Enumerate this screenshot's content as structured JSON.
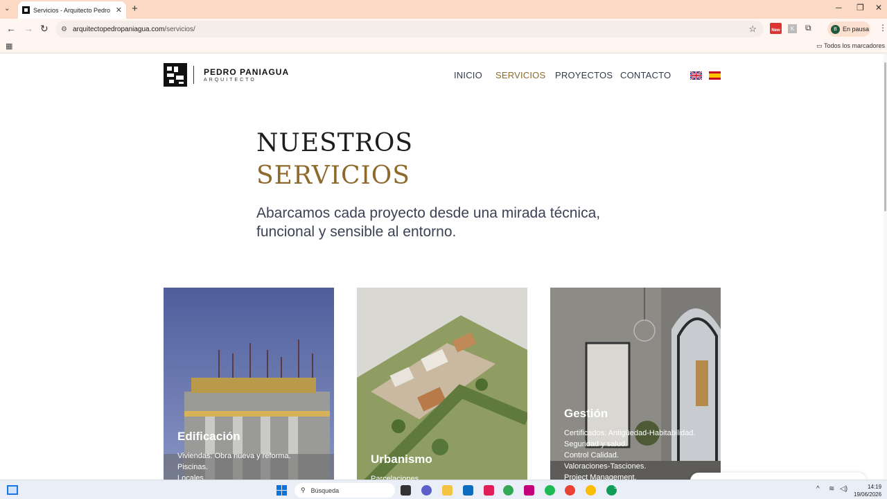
{
  "browser": {
    "tab_title": "Servicios - Arquitecto Pedro Pa",
    "url_domain": "arquitectopedropaniagua.com",
    "url_path": "/servicios/",
    "profile_initial": "B",
    "profile_status": "En pausa",
    "ext_new_label": "New",
    "bookmarks_all": "Todos los marcadores"
  },
  "site": {
    "logo_name": "PEDRO PANIAGUA",
    "logo_sub": "ARQUITECTO",
    "nav": [
      {
        "label": "INICIO"
      },
      {
        "label": "SERVICIOS"
      },
      {
        "label": "PROYECTOS"
      },
      {
        "label": "CONTACTO"
      }
    ],
    "heading_line1": "NUESTROS",
    "heading_line2": "SERVICIOS",
    "lead": "Abarcamos cada proyecto desde una mirada técnica, funcional y sensible al entorno.",
    "cards": [
      {
        "title": "Edificación",
        "items": [
          "Viviendas: Obra nueva y reforma.",
          "Piscinas.",
          "Locales."
        ]
      },
      {
        "title": "Urbanismo",
        "items": [
          "Parcelaciones."
        ]
      },
      {
        "title": "Gestión",
        "items": [
          "Certificados: Antigüedad-Habitabilidad.",
          "Seguridad y salud.",
          "Control Calidad.",
          "Valoraciones-Tasciones.",
          "Project Management."
        ]
      }
    ]
  },
  "taskbar": {
    "search_placeholder": "Búsqueda",
    "time": "14:19",
    "date": "19/06/2026",
    "badge_count": "5"
  },
  "colors": {
    "accent": "#8d6a2c",
    "chrome": "#fbd9c4",
    "text": "#3c4254"
  }
}
